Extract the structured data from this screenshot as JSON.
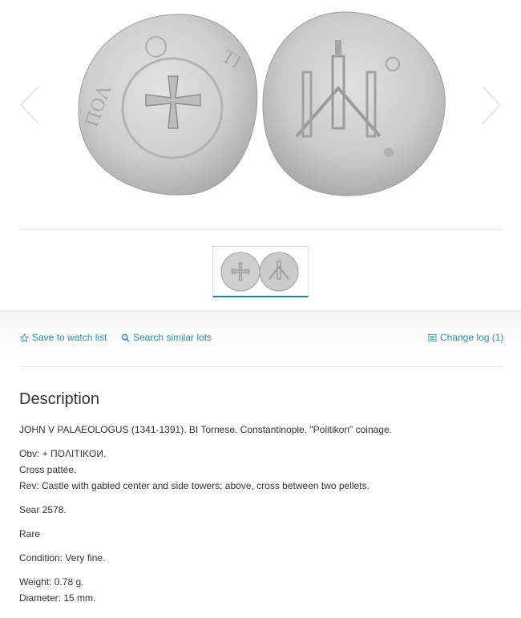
{
  "gallery": {
    "main_image_alt": "Coin obverse and reverse",
    "thumbnail_alt": "Coin thumbnail"
  },
  "actions": {
    "watch_label": "Save to watch list",
    "similar_label": "Search similar lots",
    "changelog_label": "Change log (1)"
  },
  "description": {
    "heading": "Description",
    "title_line": "JOHN V PALAEOLOGUS (1341-1391). BI Tornese. Constantinople. \"Politikon\" coinage.",
    "obv": "Obv: + ΠOΛITIKOИ.",
    "obv_detail": "Cross pattée.",
    "rev": "Rev: Castle with gabled center and side towers; above, cross between two pellets.",
    "reference": "Sear 2578.",
    "rarity": "Rare",
    "condition": "Condition: Very fine.",
    "weight": "Weight: 0.78 g.",
    "diameter": "Diameter: 15 mm."
  },
  "colors": {
    "link": "#2a8fb8",
    "thumb_active": "#2a7fa8",
    "coin_silver": "#c9c9c9"
  },
  "icons": {
    "watch": "star-outline-icon",
    "similar": "search-icon",
    "changelog": "list-icon",
    "prev": "chevron-left-icon",
    "next": "chevron-right-icon"
  }
}
